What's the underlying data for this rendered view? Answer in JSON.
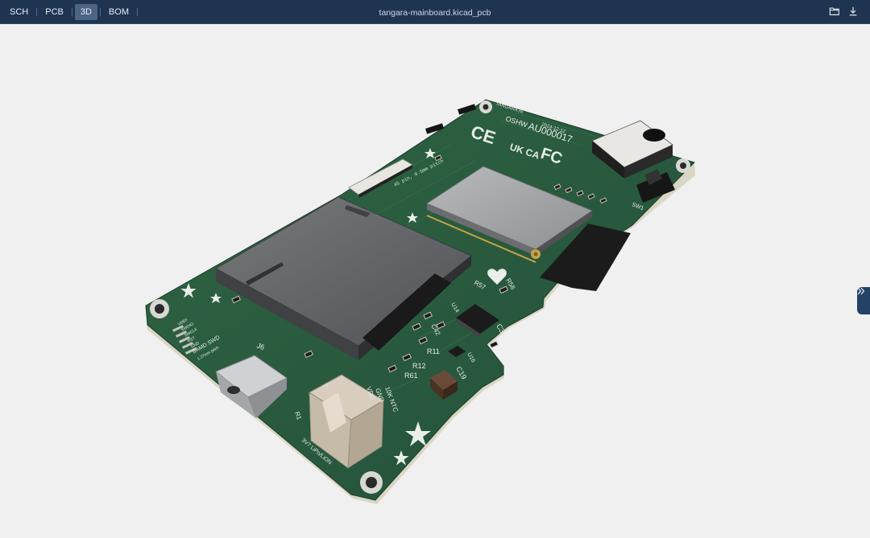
{
  "toolbar": {
    "tabs": [
      {
        "label": "SCH",
        "active": false
      },
      {
        "label": "PCB",
        "active": false
      },
      {
        "label": "3D",
        "active": true
      },
      {
        "label": "BOM",
        "active": false
      }
    ],
    "filename": "tangara-mainboard.kicad_pcb",
    "actions": {
      "open": "folder-open-icon",
      "download": "download-icon"
    }
  },
  "board": {
    "silkscreen": {
      "header_title": "TANGARA r6",
      "date": "2024-12-12",
      "oshw": "OSHW",
      "oshw_id": "AU000017",
      "ce": "CE",
      "ukca": "UK CA",
      "fc": "FC",
      "ffc": "45 pin, 0.5mm pitch",
      "swd_pins": [
        "VREF",
        "SWDIO",
        "SWCLK",
        "RST",
        "GND"
      ],
      "swd_title": "SAMD SWD",
      "swd_pitch": "1.27mm pitch",
      "j6": "J6",
      "battery": "3V7 LiPo/LiON",
      "ntc": "10K NTC",
      "vdd": "VDD",
      "gnd": "GND",
      "t": "T",
      "r1": "R1",
      "r11": "R11",
      "r12": "R12",
      "r61": "R61",
      "r57": "R57",
      "r58": "R58",
      "u14": "U14",
      "c42": "C42",
      "c31": "C31",
      "u16": "U16",
      "c19": "C19",
      "sw1": "SW1",
      "r56": "R56"
    }
  },
  "side_handle": "chevron-double-right-icon",
  "colors": {
    "toolbar": "#1f3450",
    "active_tab": "#4c6585",
    "pcb": "#2a5a3a",
    "viewport": "#f0f0f0"
  }
}
